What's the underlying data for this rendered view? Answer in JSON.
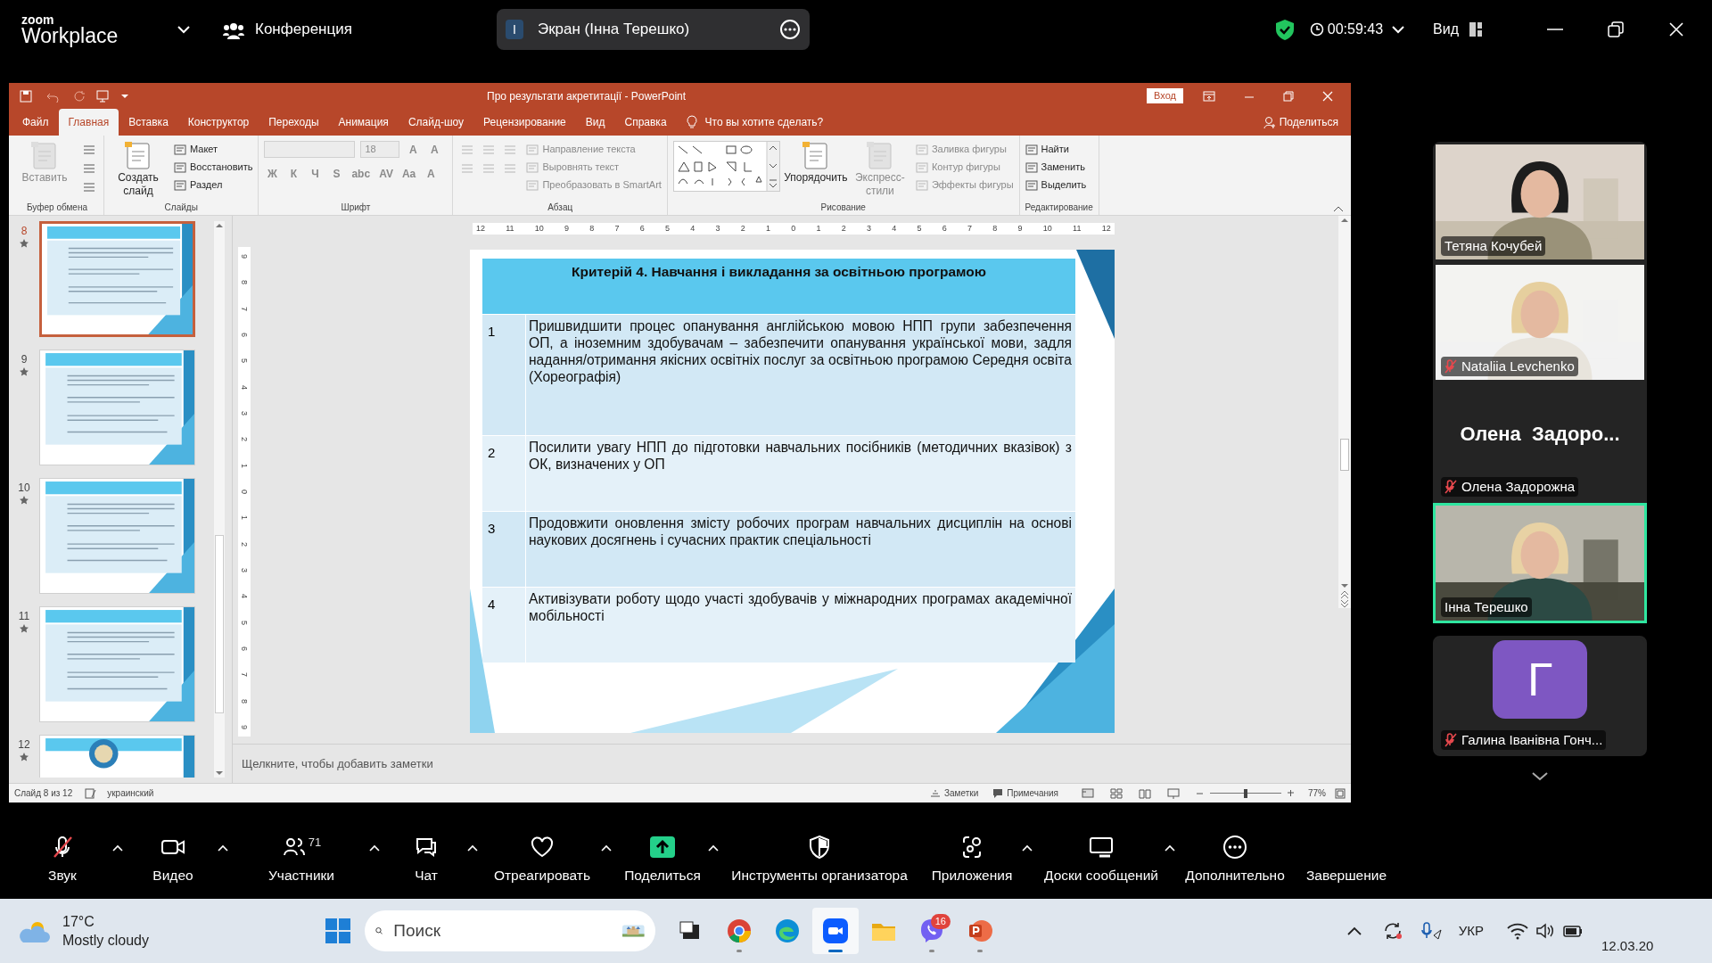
{
  "zoom_bar": {
    "logo_top": "zoom",
    "logo_bottom": "Workplace",
    "meeting": "Конференция",
    "share_initial": "I",
    "share_label": "Экран (Інна Терешко)",
    "timer": "00:59:43",
    "view": "Вид"
  },
  "ppt": {
    "title": "Про результати акретитації  -  PowerPoint",
    "signin": "Вход",
    "share": "Поделиться",
    "tell_me": "Что вы хотите сделать?",
    "tabs": [
      {
        "label": "Файл",
        "selected": false
      },
      {
        "label": "Главная",
        "selected": true
      },
      {
        "label": "Вставка",
        "selected": false
      },
      {
        "label": "Конструктор",
        "selected": false
      },
      {
        "label": "Переходы",
        "selected": false
      },
      {
        "label": "Анимация",
        "selected": false
      },
      {
        "label": "Слайд-шоу",
        "selected": false
      },
      {
        "label": "Рецензирование",
        "selected": false
      },
      {
        "label": "Вид",
        "selected": false
      },
      {
        "label": "Справка",
        "selected": false
      }
    ],
    "ribbon": [
      {
        "label": "Буфер обмена",
        "items": [
          {
            "kind": "large",
            "label": "Вставить",
            "disabled": true
          },
          {
            "kind": "tools",
            "disabled": false
          }
        ]
      },
      {
        "label": "Слайды",
        "items": [
          {
            "kind": "large",
            "label": "Создать слайд",
            "disabled": false
          },
          {
            "kind": "small",
            "label": "Макет",
            "disabled": false
          },
          {
            "kind": "small",
            "label": "Восстановить",
            "disabled": false
          },
          {
            "kind": "small",
            "label": "Раздел",
            "disabled": false
          }
        ]
      },
      {
        "label": "Шрифт",
        "items": [
          {
            "kind": "field",
            "disabled": true
          },
          {
            "kind": "field",
            "label": "18",
            "disabled": true
          },
          {
            "kind": "glyph",
            "label": "A",
            "disabled": true
          },
          {
            "kind": "glyph",
            "label": "A",
            "disabled": true
          },
          {
            "kind": "glyph",
            "label": "Ж",
            "disabled": true
          },
          {
            "kind": "glyph",
            "label": "К",
            "disabled": true
          },
          {
            "kind": "glyph",
            "label": "Ч",
            "disabled": true
          },
          {
            "kind": "glyph",
            "label": "S",
            "disabled": true
          },
          {
            "kind": "glyph",
            "label": "abc",
            "disabled": true
          },
          {
            "kind": "glyph",
            "label": "AV",
            "disabled": true
          },
          {
            "kind": "glyph",
            "label": "Aa",
            "disabled": true
          },
          {
            "kind": "glyph",
            "label": "A",
            "disabled": true
          }
        ]
      },
      {
        "label": "Абзац",
        "items": [
          {
            "kind": "tools",
            "disabled": true
          },
          {
            "kind": "small",
            "label": "Направление текста",
            "disabled": true
          },
          {
            "kind": "small",
            "label": "Выровнять текст",
            "disabled": true
          },
          {
            "kind": "small",
            "label": "Преобразовать в SmartArt",
            "disabled": true
          }
        ]
      },
      {
        "label": "Рисование",
        "items": [
          {
            "kind": "gallery",
            "disabled": false
          },
          {
            "kind": "large",
            "label": "Упорядочить",
            "disabled": false
          },
          {
            "kind": "large",
            "label": "Экспресс-стили",
            "disabled": true
          },
          {
            "kind": "small",
            "label": "Заливка фигуры",
            "disabled": true
          },
          {
            "kind": "small",
            "label": "Контур фигуры",
            "disabled": true
          },
          {
            "kind": "small",
            "label": "Эффекты фигуры",
            "disabled": true
          }
        ]
      },
      {
        "label": "Редактирование",
        "items": [
          {
            "kind": "small",
            "label": "Найти",
            "disabled": false
          },
          {
            "kind": "small",
            "label": "Заменить",
            "disabled": false
          },
          {
            "kind": "small",
            "label": "Выделить",
            "disabled": false
          }
        ]
      }
    ],
    "slides": [
      {
        "number": "8",
        "selected": true
      },
      {
        "number": "9",
        "selected": false
      },
      {
        "number": "10",
        "selected": false
      },
      {
        "number": "11",
        "selected": false
      },
      {
        "number": "12",
        "selected": false
      }
    ],
    "ruler_h": [
      "12",
      "11",
      "10",
      "9",
      "8",
      "7",
      "6",
      "5",
      "4",
      "3",
      "2",
      "1",
      "0",
      "1",
      "2",
      "3",
      "4",
      "5",
      "6",
      "7",
      "8",
      "9",
      "10",
      "11",
      "12"
    ],
    "ruler_v": [
      "9",
      "8",
      "7",
      "6",
      "5",
      "4",
      "3",
      "2",
      "1",
      "0",
      "1",
      "2",
      "3",
      "4",
      "5",
      "6",
      "7",
      "8",
      "9"
    ],
    "slide": {
      "title": "Критерій 4. Навчання і викладання за освітньою програмою",
      "rows": [
        {
          "number": "1",
          "text": "Пришвидшити процес опанування англійською мовою НПП групи забезпечення ОП, а іноземним здобувачам – забезпечити опанування української мови, задля надання/отримання якісних освітніх послуг за освітньою програмою Середня освіта (Хореографія)"
        },
        {
          "number": "2",
          "text": "Посилити увагу НПП до підготовки навчальних посібників (методичних вказівок) з ОК, визначених у ОП"
        },
        {
          "number": "3",
          "text": "Продовжити оновлення змісту робочих програм навчальних дисциплін на основі наукових досягнень і сучасних практик спеціальності"
        },
        {
          "number": "4",
          "text": "Активізувати роботу щодо участі здобувачів у міжнародних програмах академічної мобільності"
        }
      ]
    },
    "notes_placeholder": "Щелкните, чтобы добавить заметки",
    "status": {
      "slide": "Слайд 8 из 12",
      "language": "украинский",
      "notes": "Заметки",
      "comments": "Примечания",
      "zoom": "77%",
      "level": 0.5
    }
  },
  "participants": [
    {
      "kind": "video",
      "name": "Тетяна Кочубей",
      "muted": false,
      "speaking": false
    },
    {
      "kind": "video",
      "name": "Nataliia Levchenko",
      "muted": true,
      "speaking": false
    },
    {
      "kind": "name_only",
      "display": "Олена  Задоро...",
      "name": "Олена Задорожна",
      "muted": true,
      "speaking": false
    },
    {
      "kind": "video",
      "name": "Інна Терешко",
      "muted": false,
      "speaking": true
    },
    {
      "kind": "avatar",
      "initial": "Г",
      "color": "#7e57c2",
      "name": "Галина Іванівна Гонч...",
      "muted": true,
      "speaking": false
    }
  ],
  "toolbar": [
    {
      "kind": "mic",
      "label": "Звук",
      "muted": true,
      "caret": true
    },
    {
      "kind": "video",
      "label": "Видео",
      "caret": true
    },
    {
      "kind": "participants",
      "label": "Участники",
      "count": "71",
      "caret": true
    },
    {
      "kind": "chat",
      "label": "Чат",
      "caret": true
    },
    {
      "kind": "react",
      "label": "Отреагировать",
      "caret": true
    },
    {
      "kind": "share",
      "label": "Поделиться",
      "caret": true
    },
    {
      "kind": "host",
      "label": "Инструменты организатора",
      "caret": false
    },
    {
      "kind": "apps",
      "label": "Приложения",
      "caret": true
    },
    {
      "kind": "board",
      "label": "Доски сообщений",
      "caret": true
    },
    {
      "kind": "more",
      "label": "Дополнительно",
      "caret": false
    },
    {
      "kind": "end",
      "label": "Завершение",
      "caret": false
    }
  ],
  "taskbar": {
    "temperature": "17°C",
    "weather": "Mostly cloudy",
    "search_placeholder": "Поиск",
    "apps": [
      {
        "kind": "taskview",
        "running": false,
        "active": false
      },
      {
        "kind": "chrome",
        "running": true,
        "active": false
      },
      {
        "kind": "edge",
        "running": false,
        "active": false
      },
      {
        "kind": "zoom",
        "running": true,
        "active": true
      },
      {
        "kind": "folder",
        "running": false,
        "active": false
      },
      {
        "kind": "viber",
        "running": true,
        "active": false,
        "badge": "16"
      },
      {
        "kind": "powerpoint",
        "running": true,
        "active": false
      }
    ],
    "language": "УКР",
    "date": "12.03.20"
  }
}
